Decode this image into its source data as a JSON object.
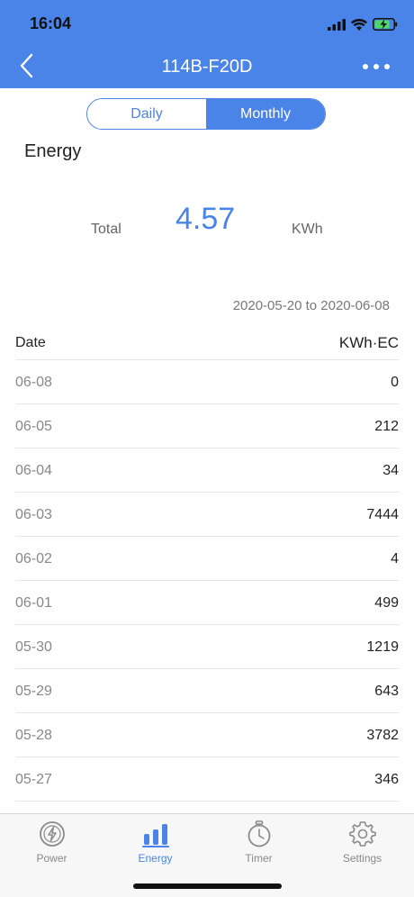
{
  "status_bar": {
    "time": "16:04"
  },
  "header": {
    "title": "114B-F20D"
  },
  "segment": {
    "daily_label": "Daily",
    "monthly_label": "Monthly",
    "selected": "Monthly"
  },
  "energy": {
    "title": "Energy",
    "total_label": "Total",
    "total_value": "4.57",
    "total_unit": "KWh"
  },
  "date_range": "2020-05-20 to 2020-06-08",
  "table": {
    "header_date": "Date",
    "header_unit": "KWh·EC",
    "rows": [
      {
        "date": "06-08",
        "value": "0"
      },
      {
        "date": "06-05",
        "value": "212"
      },
      {
        "date": "06-04",
        "value": "34"
      },
      {
        "date": "06-03",
        "value": "7444"
      },
      {
        "date": "06-02",
        "value": "4"
      },
      {
        "date": "06-01",
        "value": "499"
      },
      {
        "date": "05-30",
        "value": "1219"
      },
      {
        "date": "05-29",
        "value": "643"
      },
      {
        "date": "05-28",
        "value": "3782"
      },
      {
        "date": "05-27",
        "value": "346"
      }
    ]
  },
  "tabbar": {
    "tabs": [
      {
        "label": "Power",
        "icon": "power-icon"
      },
      {
        "label": "Energy",
        "icon": "energy-chart-icon",
        "active": true
      },
      {
        "label": "Timer",
        "icon": "timer-icon"
      },
      {
        "label": "Settings",
        "icon": "gear-icon"
      }
    ]
  },
  "colors": {
    "accent": "#4a84e8",
    "battery": "#4cd964"
  }
}
